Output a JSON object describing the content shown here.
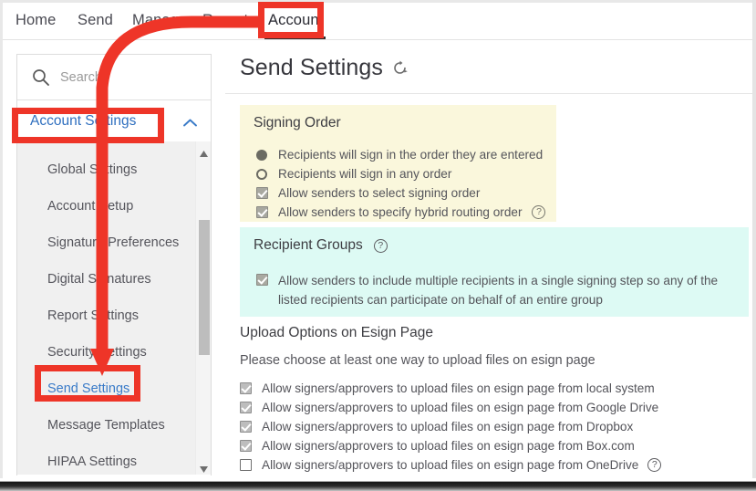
{
  "topnav": {
    "items": [
      {
        "label": "Home",
        "active": false
      },
      {
        "label": "Send",
        "active": false
      },
      {
        "label": "Manage",
        "active": false
      },
      {
        "label": "Reports",
        "active": false
      },
      {
        "label": "Account",
        "active": true
      }
    ]
  },
  "sidebar": {
    "search": {
      "placeholder": "Search",
      "value": "",
      "icon": "search-icon"
    },
    "group": {
      "label": "Account Settings",
      "expanded": true,
      "chevron_icon": "chevron-up-icon"
    },
    "items": [
      {
        "label": "Global Settings",
        "selected": false
      },
      {
        "label": "Account Setup",
        "selected": false
      },
      {
        "label": "Signature Preferences",
        "selected": false
      },
      {
        "label": "Digital Signatures",
        "selected": false
      },
      {
        "label": "Report Settings",
        "selected": false
      },
      {
        "label": "Security Settings",
        "selected": false
      },
      {
        "label": "Send Settings",
        "selected": true
      },
      {
        "label": "Message Templates",
        "selected": false
      },
      {
        "label": "HIPAA Settings",
        "selected": false
      }
    ],
    "scroll_up_icon": "scroll-arrow-up-icon",
    "scroll_down_icon": "scroll-arrow-down-icon"
  },
  "main": {
    "title": "Send Settings",
    "refresh_icon": "refresh-icon",
    "signing_order": {
      "heading": "Signing Order",
      "options": [
        {
          "label": "Recipients will sign in the order they are entered",
          "control": "radio",
          "checked": true,
          "help": false
        },
        {
          "label": "Recipients will sign in any order",
          "control": "radio",
          "checked": false,
          "help": false
        },
        {
          "label": "Allow senders to select signing order",
          "control": "checkbox",
          "checked": true,
          "help": false
        },
        {
          "label": "Allow senders to specify hybrid routing order",
          "control": "checkbox",
          "checked": true,
          "help": true
        }
      ]
    },
    "recipient_groups": {
      "heading": "Recipient Groups",
      "help": true,
      "option": {
        "label": "Allow senders to include multiple recipients in a single signing step so any of the listed recipients can participate on behalf of an entire group",
        "checked": true
      }
    },
    "upload_options": {
      "heading": "Upload Options on Esign Page",
      "subtext": "Please choose at least one way to upload files on esign page",
      "options": [
        {
          "label": "Allow signers/approvers to upload files on esign page from local system",
          "checked": true,
          "help": false
        },
        {
          "label": "Allow signers/approvers to upload files on esign page from Google Drive",
          "checked": true,
          "help": false
        },
        {
          "label": "Allow signers/approvers to upload files on esign page from Dropbox",
          "checked": true,
          "help": false
        },
        {
          "label": "Allow signers/approvers to upload files on esign page from Box.com",
          "checked": true,
          "help": false
        },
        {
          "label": "Allow signers/approvers to upload files on esign page from OneDrive",
          "checked": false,
          "help": true
        }
      ]
    }
  },
  "annotations": {
    "color": "#ee3528",
    "boxes": [
      {
        "name": "account-tab-highlight",
        "target": "Account"
      },
      {
        "name": "account-settings-highlight",
        "target": "Account Settings"
      },
      {
        "name": "send-settings-highlight",
        "target": "Send Settings"
      }
    ],
    "arrow": {
      "name": "callout-arrow",
      "from": "Account",
      "to": "Send Settings"
    }
  },
  "colors": {
    "annotation_red": "#ee3528",
    "panel_yellow": "#faf7dc",
    "panel_teal": "#ddfaf4",
    "link_blue": "#3a7bc8",
    "sidebar_bg": "#f0f0f0"
  }
}
